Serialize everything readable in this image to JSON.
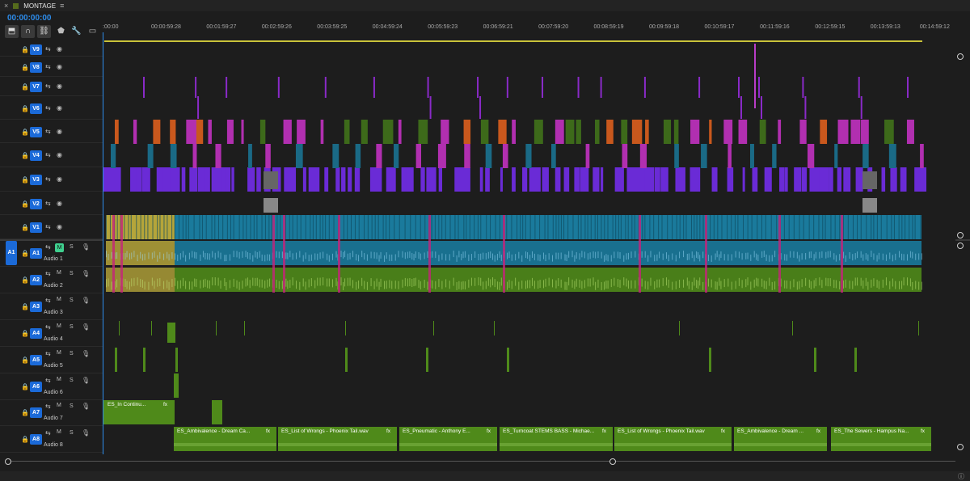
{
  "panel": {
    "close": "×",
    "title": "MONTAGE",
    "menu": "≡"
  },
  "timecode": "00:00:00:00",
  "tools": [
    "insert-icon",
    "snap-icon",
    "linked-icon",
    "marker-icon",
    "wrench-icon",
    "captions-icon"
  ],
  "ruler_ticks": [
    ":00:00",
    "00:00:59:28",
    "00:01:59:27",
    "00:02:59:26",
    "00:03:59:25",
    "00:04:59:24",
    "00:05:59:23",
    "00:06:59:21",
    "00:07:59:20",
    "00:08:59:19",
    "00:09:59:18",
    "00:10:59:17",
    "00:11:59:16",
    "00:12:59:15",
    "00:13:59:13",
    "00:14:59:12"
  ],
  "video_tracks": [
    "V9",
    "V8",
    "V7",
    "V6",
    "V5",
    "V4",
    "V3",
    "V2",
    "V1"
  ],
  "audio_tracks": [
    {
      "id": "A1",
      "name": "Audio 1"
    },
    {
      "id": "A2",
      "name": "Audio 2"
    },
    {
      "id": "A3",
      "name": "Audio 3"
    },
    {
      "id": "A4",
      "name": "Audio 4"
    },
    {
      "id": "A5",
      "name": "Audio 5"
    },
    {
      "id": "A6",
      "name": "Audio 6"
    },
    {
      "id": "A7",
      "name": "Audio 7"
    },
    {
      "id": "A8",
      "name": "Audio 8"
    }
  ],
  "source_patch": "A1",
  "mute_label": "M",
  "solo_label": "S",
  "a7_clip": "ES_In Continu...",
  "a8_clips": [
    "ES_Ambivalence - Dream Ca...",
    "ES_List of Wrongs - Phoenix Tail.wav",
    "ES_Pneumatic - Anthony E...",
    "ES_Turncoat STEMS BASS - Michae...",
    "ES_List of Wrongs - Phoenix Tail.wav",
    "ES_Ambivalence - Dream ...",
    "ES_The Sewers - Hampus Na..."
  ],
  "fx_label": "fx",
  "colors": {
    "accent": "#2d8ceb",
    "v1": "#1a7a9c",
    "audio": "#4f8a1a",
    "v3": "#6a2bd6",
    "v4": "#b12fb0",
    "v5_orange": "#c9581d",
    "pink": "#c6237a",
    "yellow": "#b5a53a"
  }
}
